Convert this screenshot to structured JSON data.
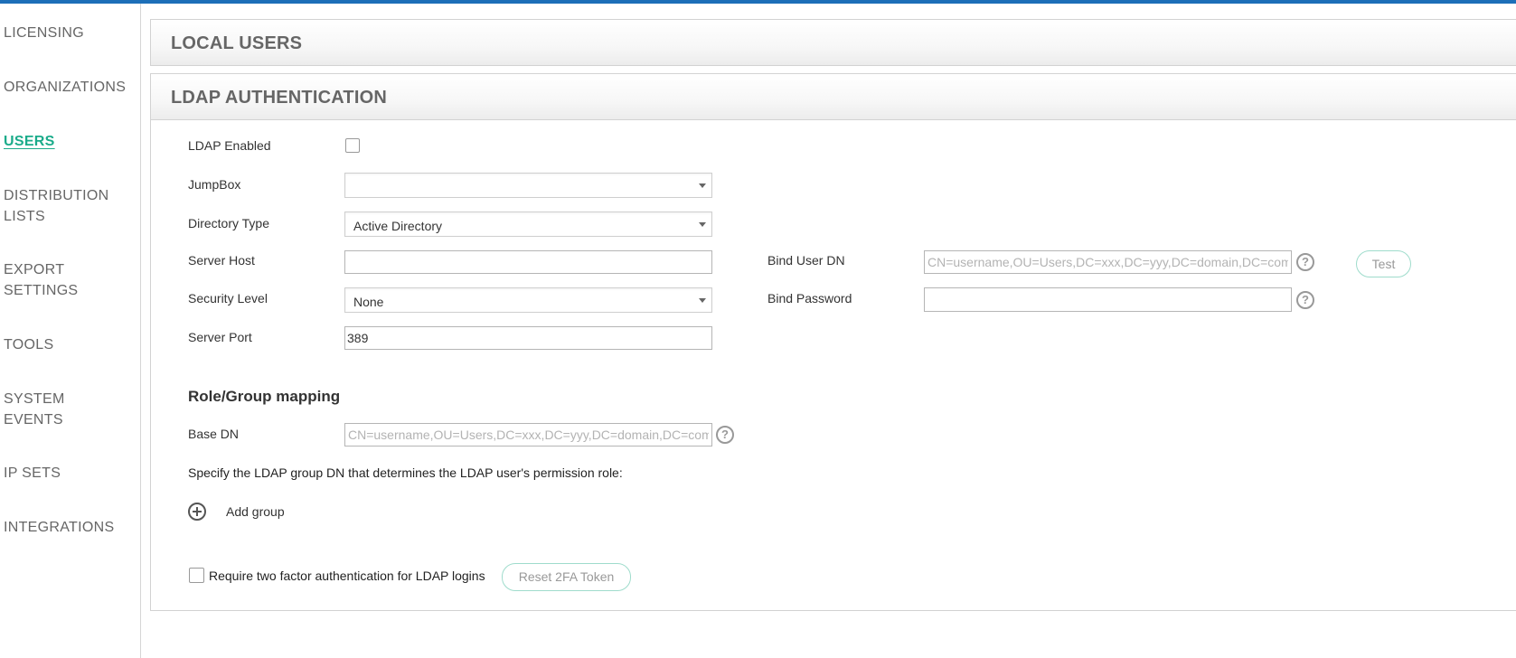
{
  "sidebar": {
    "items": [
      {
        "label": "LICENSING"
      },
      {
        "label": "ORGANIZATIONS"
      },
      {
        "label": "USERS"
      },
      {
        "label": "DISTRIBUTION LISTS",
        "line1": "DISTRIBUTION",
        "line2": "LISTS"
      },
      {
        "label": "EXPORT SETTINGS",
        "line1": "EXPORT",
        "line2": "SETTINGS"
      },
      {
        "label": "TOOLS"
      },
      {
        "label": "SYSTEM EVENTS",
        "line1": "SYSTEM",
        "line2": "EVENTS"
      },
      {
        "label": "IP SETS"
      },
      {
        "label": "INTEGRATIONS"
      }
    ],
    "active": "USERS"
  },
  "panels": {
    "local_users": {
      "title": "LOCAL USERS"
    },
    "ldap": {
      "title": "LDAP AUTHENTICATION"
    }
  },
  "ldap_form": {
    "enabled": {
      "label": "LDAP Enabled",
      "checked": false
    },
    "jumpbox": {
      "label": "JumpBox",
      "value": ""
    },
    "directory_type": {
      "label": "Directory Type",
      "value": "Active Directory"
    },
    "server_host": {
      "label": "Server Host",
      "value": ""
    },
    "security_level": {
      "label": "Security Level",
      "value": "None"
    },
    "server_port": {
      "label": "Server Port",
      "value": "389"
    },
    "bind_user_dn": {
      "label": "Bind User DN",
      "value": "",
      "placeholder": "CN=username,OU=Users,DC=xxx,DC=yyy,DC=domain,DC=com"
    },
    "bind_password": {
      "label": "Bind Password",
      "value": ""
    },
    "test_button": "Test",
    "help_glyph": "?"
  },
  "role_mapping": {
    "title": "Role/Group mapping",
    "base_dn": {
      "label": "Base DN",
      "value": "",
      "placeholder": "CN=username,OU=Users,DC=xxx,DC=yyy,DC=domain,DC=com"
    },
    "instruction": "Specify the LDAP group DN that determines the LDAP user's permission role:",
    "add_group": "Add group"
  },
  "two_factor": {
    "label": "Require two factor authentication for LDAP logins",
    "checked": false,
    "reset_button": "Reset 2FA Token"
  },
  "colors": {
    "accent": "#1aab8a",
    "topbar": "#1d6fb8",
    "button_border": "#9fdccc"
  }
}
